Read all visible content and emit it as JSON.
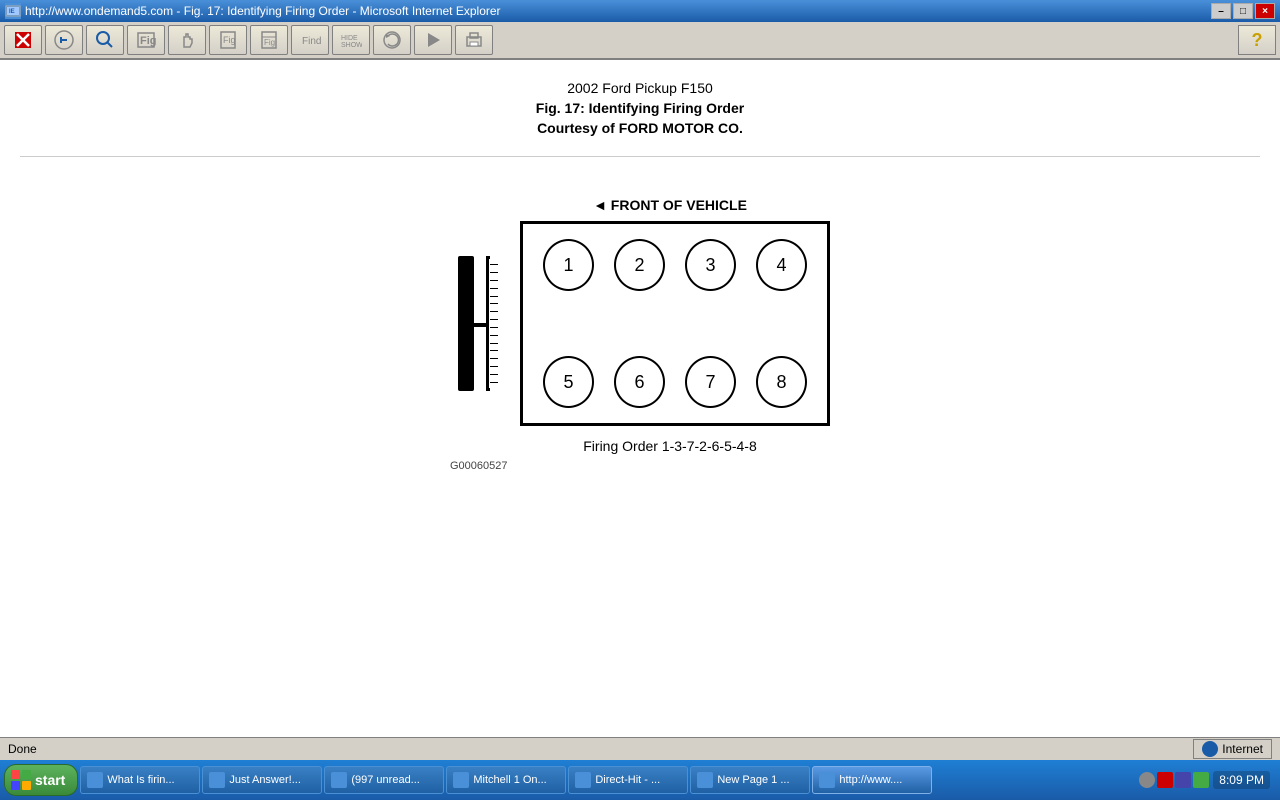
{
  "titlebar": {
    "title": "http://www.ondemand5.com - Fig. 17: Identifying Firing Order - Microsoft Internet Explorer",
    "close_btn": "×",
    "min_btn": "–",
    "max_btn": "□"
  },
  "toolbar": {
    "buttons": [
      {
        "name": "close-btn",
        "symbol": "✕",
        "color": "#c00"
      },
      {
        "name": "back-btn",
        "symbol": "⚲"
      },
      {
        "name": "search-btn",
        "symbol": "🔍"
      },
      {
        "name": "image-btn",
        "symbol": "🖼"
      },
      {
        "name": "hand-btn",
        "symbol": "✋"
      },
      {
        "name": "fig-btn",
        "symbol": "📄"
      },
      {
        "name": "fig2-btn",
        "symbol": "📑"
      },
      {
        "name": "find-btn",
        "symbol": "🔎"
      },
      {
        "name": "hideshow-btn",
        "symbol": "▤"
      },
      {
        "name": "refresh-btn",
        "symbol": "↺"
      },
      {
        "name": "refresh2-btn",
        "symbol": "↻"
      },
      {
        "name": "print-btn",
        "symbol": "🖨"
      }
    ],
    "help_btn": "?"
  },
  "content": {
    "title_line1": "2002 Ford Pickup F150",
    "title_line2": "Fig. 17: Identifying Firing Order",
    "title_line3": "Courtesy of FORD MOTOR CO.",
    "front_label": "◄ FRONT OF VEHICLE",
    "cylinders_top": [
      "①",
      "②",
      "③",
      "④"
    ],
    "cylinders_bottom": [
      "⑤",
      "⑥",
      "⑦",
      "⑧"
    ],
    "firing_order_text": "Firing Order 1-3-7-2-6-5-4-8",
    "part_number": "G00060527"
  },
  "statusbar": {
    "status": "Done",
    "zone": "Internet"
  },
  "taskbar": {
    "start_label": "start",
    "items": [
      {
        "label": "What Is firin...",
        "active": false
      },
      {
        "label": "Just Answer!...",
        "active": false
      },
      {
        "label": "(997 unread...",
        "active": false
      },
      {
        "label": "Mitchell 1 On...",
        "active": false
      },
      {
        "label": "Direct-Hit - ...",
        "active": false
      },
      {
        "label": "New Page 1 ...",
        "active": false
      },
      {
        "label": "http://www....",
        "active": true
      }
    ],
    "clock": "8:09 PM"
  }
}
